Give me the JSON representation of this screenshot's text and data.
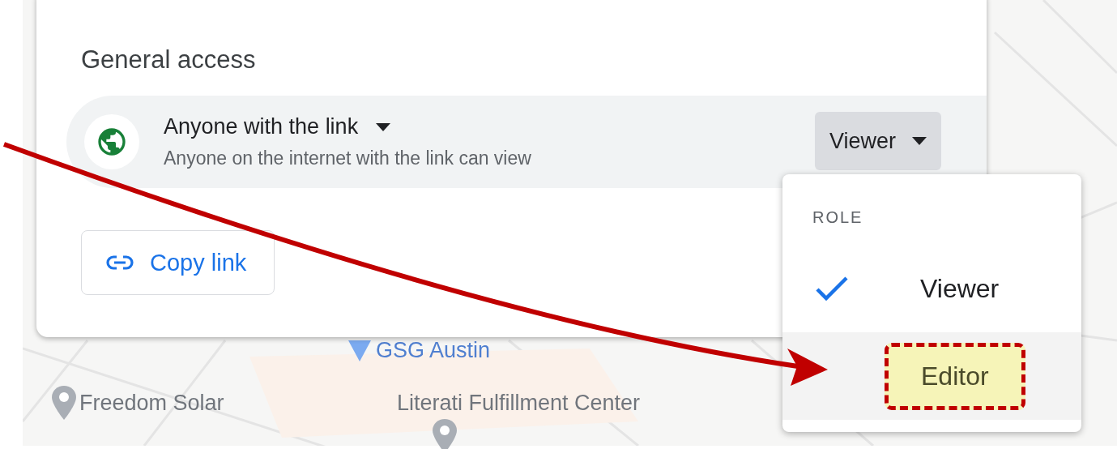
{
  "map": {
    "places": [
      {
        "name": "GSG Austin",
        "kind": "blue"
      },
      {
        "name": "Freedom Solar",
        "kind": "gray"
      },
      {
        "name": "Literati Fulfillment Center",
        "kind": "gray"
      }
    ]
  },
  "general_access": {
    "title": "General access",
    "access": {
      "label": "Anyone with the link",
      "description": "Anyone on the internet with the link can view"
    },
    "role_button": {
      "label": "Viewer"
    },
    "copy_link": {
      "label": "Copy link"
    }
  },
  "role_menu": {
    "heading": "ROLE",
    "items": [
      {
        "label": "Viewer",
        "selected": true,
        "annotated": false
      },
      {
        "label": "Editor",
        "selected": false,
        "annotated": true
      }
    ]
  }
}
